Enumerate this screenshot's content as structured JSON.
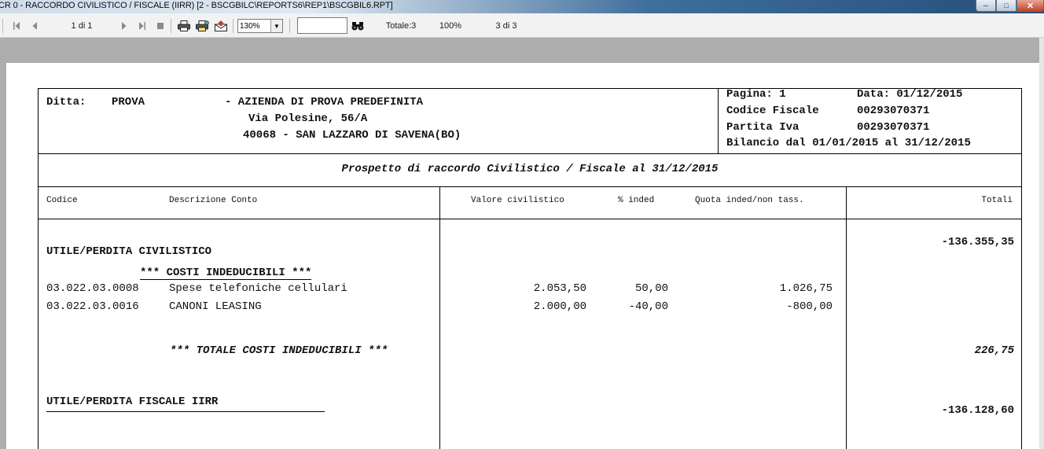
{
  "window": {
    "title": "CR 0 - RACCORDO CIVILISTICO / FISCALE (IIRR) [2 - BSCGBILC\\REPORTS6\\REP1\\BSCGBIL6.RPT]"
  },
  "toolbar": {
    "page_indicator": "1 di 1",
    "zoom_value": "130%",
    "search_value": "",
    "total_label": "Totale:3",
    "percent_label": "100%",
    "count_label": "3 di 3"
  },
  "report": {
    "header": {
      "ditta_label": "Ditta:",
      "ditta_code": "PROVA",
      "company_name": "- AZIENDA DI PROVA PREDEFINITA",
      "address_line1": "Via Polesine, 56/A",
      "address_line2": "40068 - SAN LAZZARO DI SAVENA(BO)",
      "pagina": "Pagina: 1",
      "data": "Data: 01/12/2015",
      "codice_fiscale_label": "Codice Fiscale",
      "codice_fiscale_value": "00293070371",
      "partita_iva_label": "Partita Iva",
      "partita_iva_value": "00293070371",
      "bilancio": "Bilancio dal 01/01/2015 al 31/12/2015"
    },
    "report_title": "Prospetto di raccordo Civilistico / Fiscale al 31/12/2015",
    "columns": {
      "codice": "Codice",
      "descrizione": "Descrizione Conto",
      "valore": "Valore civilistico",
      "perc": "% inded",
      "quota": "Quota inded/non tass.",
      "totali": "Totali"
    },
    "utile_civ_label": "UTILE/PERDITA CIVILISTICO",
    "utile_civ_total": "-136.355,35",
    "section_title": "*** COSTI INDEDUCIBILI ***",
    "rows": [
      {
        "codice": "03.022.03.0008",
        "descrizione": "Spese telefoniche cellulari",
        "valore": "2.053,50",
        "perc": "50,00",
        "quota": "1.026,75"
      },
      {
        "codice": "03.022.03.0016",
        "descrizione": "CANONI LEASING",
        "valore": "2.000,00",
        "perc": "-40,00",
        "quota": "-800,00"
      }
    ],
    "totale_label": "*** TOTALE COSTI INDEDUCIBILI ***",
    "totale_value": "226,75",
    "utile_fisc_label": "UTILE/PERDITA FISCALE IIRR",
    "utile_fisc_total": "-136.128,60"
  }
}
